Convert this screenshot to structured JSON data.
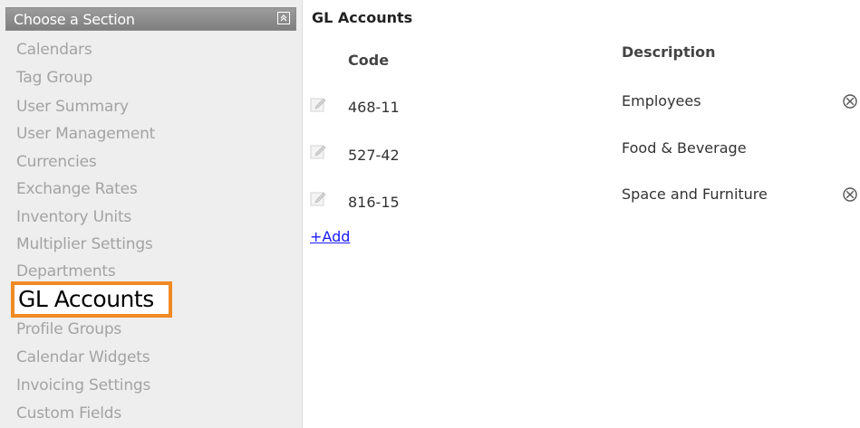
{
  "sidebar": {
    "header_title": "Choose a Section",
    "items": [
      {
        "label": "Calendars"
      },
      {
        "label": "Tag Group"
      },
      {
        "label": "User Summary"
      },
      {
        "label": "User Management"
      },
      {
        "label": "Currencies"
      },
      {
        "label": "Exchange Rates"
      },
      {
        "label": "Inventory Units"
      },
      {
        "label": "Multiplier Settings"
      },
      {
        "label": "Departments"
      },
      {
        "label": "GL Accounts"
      },
      {
        "label": "Profile Groups"
      },
      {
        "label": "Calendar Widgets"
      },
      {
        "label": "Invoicing Settings"
      },
      {
        "label": "Custom Fields"
      }
    ],
    "active_label": "GL Accounts",
    "active_color": "#f08a24"
  },
  "main": {
    "title": "GL Accounts",
    "columns": {
      "code": "Code",
      "description": "Description"
    },
    "rows": [
      {
        "code": "468-11",
        "description": "Employees",
        "deletable": true
      },
      {
        "code": "527-42",
        "description": "Food & Beverage",
        "deletable": false
      },
      {
        "code": "816-15",
        "description": "Space and Furniture",
        "deletable": true
      }
    ],
    "add_label": "+Add",
    "link_color": "#1a1aff"
  },
  "icons": {
    "collapse": "collapse-up-icon",
    "edit": "pencil-icon",
    "delete": "circle-x-icon"
  }
}
